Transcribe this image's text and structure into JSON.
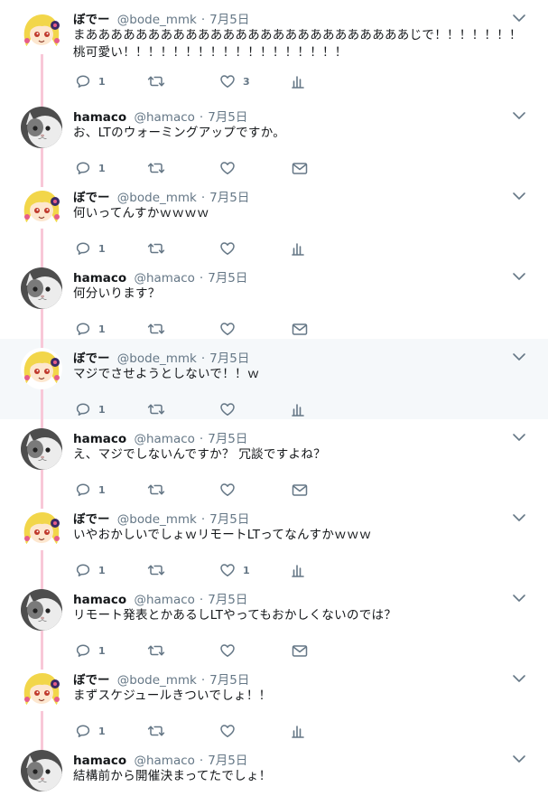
{
  "tweets": [
    {
      "name": "ぼでー",
      "handle": "@bode_mmk",
      "date": "7月5日",
      "avatar": "girl",
      "lines": [
        "まああああああああああああああああああああああああああじで！！！！！！！",
        "桃可愛い！！！！！！！！！！！！！！！！！！"
      ],
      "reply": "1",
      "retweet": "",
      "like": "3",
      "last": "analytics-icon"
    },
    {
      "name": "hamaco",
      "handle": "@hamaco",
      "date": "7月5日",
      "avatar": "cat",
      "lines": [
        "お、LTのウォーミングアップですか。"
      ],
      "reply": "1",
      "retweet": "",
      "like": "",
      "last": "mail-icon"
    },
    {
      "name": "ぼでー",
      "handle": "@bode_mmk",
      "date": "7月5日",
      "avatar": "girl",
      "lines": [
        "何いってんすかｗｗｗｗ"
      ],
      "reply": "1",
      "retweet": "",
      "like": "",
      "last": "analytics-icon"
    },
    {
      "name": "hamaco",
      "handle": "@hamaco",
      "date": "7月5日",
      "avatar": "cat",
      "lines": [
        "何分いります？"
      ],
      "reply": "1",
      "retweet": "",
      "like": "",
      "last": "mail-icon"
    },
    {
      "name": "ぼでー",
      "handle": "@bode_mmk",
      "date": "7月5日",
      "avatar": "girl",
      "lines": [
        "マジでさせようとしないで！！ｗ"
      ],
      "reply": "1",
      "retweet": "",
      "like": "",
      "last": "analytics-icon"
    },
    {
      "name": "hamaco",
      "handle": "@hamaco",
      "date": "7月5日",
      "avatar": "cat",
      "lines": [
        "え、マジでしないんですか？ 冗談ですよね？"
      ],
      "reply": "1",
      "retweet": "",
      "like": "",
      "last": "mail-icon"
    },
    {
      "name": "ぼでー",
      "handle": "@bode_mmk",
      "date": "7月5日",
      "avatar": "girl",
      "lines": [
        "いやおかしいでしょｗリモートLTってなんすかｗｗｗ"
      ],
      "reply": "1",
      "retweet": "",
      "like": "1",
      "last": "analytics-icon"
    },
    {
      "name": "hamaco",
      "handle": "@hamaco",
      "date": "7月5日",
      "avatar": "cat",
      "lines": [
        "リモート発表とかあるしLTやってもおかしくないのでは？"
      ],
      "reply": "1",
      "retweet": "",
      "like": "",
      "last": "mail-icon"
    },
    {
      "name": "ぼでー",
      "handle": "@bode_mmk",
      "date": "7月5日",
      "avatar": "girl",
      "lines": [
        "まずスケジュールきついでしょ！！"
      ],
      "reply": "1",
      "retweet": "",
      "like": "",
      "last": "analytics-icon"
    },
    {
      "name": "hamaco",
      "handle": "@hamaco",
      "date": "7月5日",
      "avatar": "cat",
      "lines": [
        "結構前から開催決まってたでしょ！"
      ],
      "reply": "",
      "retweet": "",
      "like": "",
      "last": "mail-icon"
    }
  ],
  "separator": "·",
  "colors": {
    "thread_line": "#f8c8d8",
    "icon": "#657786",
    "highlight_bg": "#f5f8fa"
  }
}
